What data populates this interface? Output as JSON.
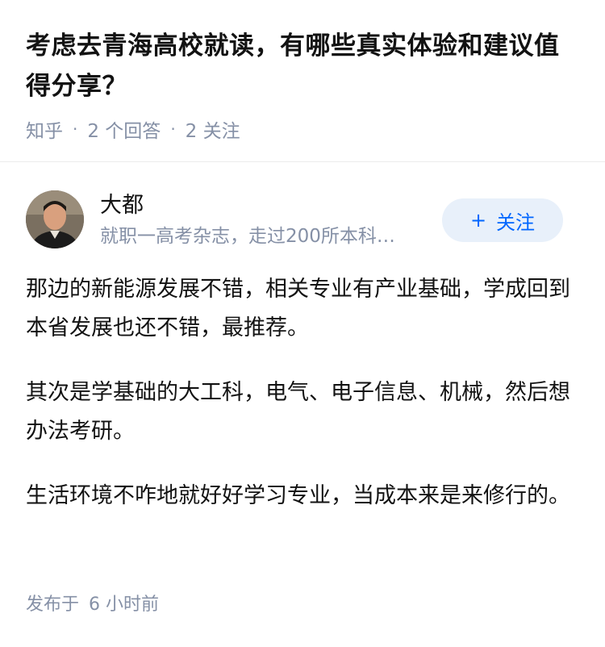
{
  "question": {
    "title": "考虑去青海高校就读，有哪些真实体验和建议值得分享？"
  },
  "meta": {
    "source": "知乎",
    "separator": "·",
    "answers": "2 个回答",
    "followers": "2 关注"
  },
  "author": {
    "name": "大都",
    "bio": "就职一高考杂志，走过200所本科…",
    "follow_icon": "+",
    "follow_label": "关注"
  },
  "answer": {
    "paragraphs": [
      "那边的新能源发展不错，相关专业有产业基础，学成回到本省发展也还不错，最推荐。",
      "其次是学基础的大工科，电气、电子信息、机械，然后想办法考研。",
      "生活环境不咋地就好好学习专业，当成本来是来修行的。"
    ]
  },
  "footer": {
    "published_label": "发布于",
    "published_time": "6 小时前"
  }
}
